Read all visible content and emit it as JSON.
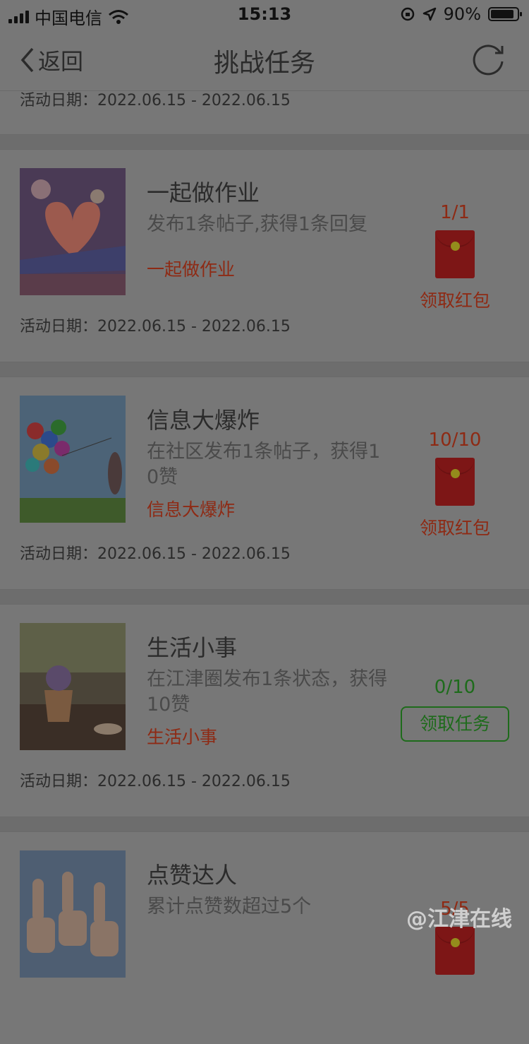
{
  "status_bar": {
    "carrier": "中国电信",
    "time": "15:13",
    "battery": "90%",
    "battery_level": 0.9
  },
  "nav": {
    "back_label": "返回",
    "title": "挑战任务"
  },
  "top_item": {
    "date": "活动日期：2022.06.15 - 2022.06.15"
  },
  "tasks": [
    {
      "title": "一起做作业",
      "desc": "发布1条帖子,获得1条回复",
      "tag": "一起做作业",
      "count": "1/1",
      "action": "领取红包",
      "date": "活动日期：2022.06.15 - 2022.06.15"
    },
    {
      "title": "信息大爆炸",
      "desc": "在社区发布1条帖子，获得10赞",
      "tag": "信息大爆炸",
      "count": "10/10",
      "action": "领取红包",
      "date": "活动日期：2022.06.15 - 2022.06.15"
    },
    {
      "title": "生活小事",
      "desc": "在江津圈发布1条状态，获得10赞",
      "tag": "生活小事",
      "count": "0/10",
      "action": "领取任务",
      "date": "活动日期：2022.06.15 - 2022.06.15"
    },
    {
      "title": "点赞达人",
      "desc": "累计点赞数超过5个",
      "count": "5/5"
    }
  ],
  "watermark": "@江津在线"
}
